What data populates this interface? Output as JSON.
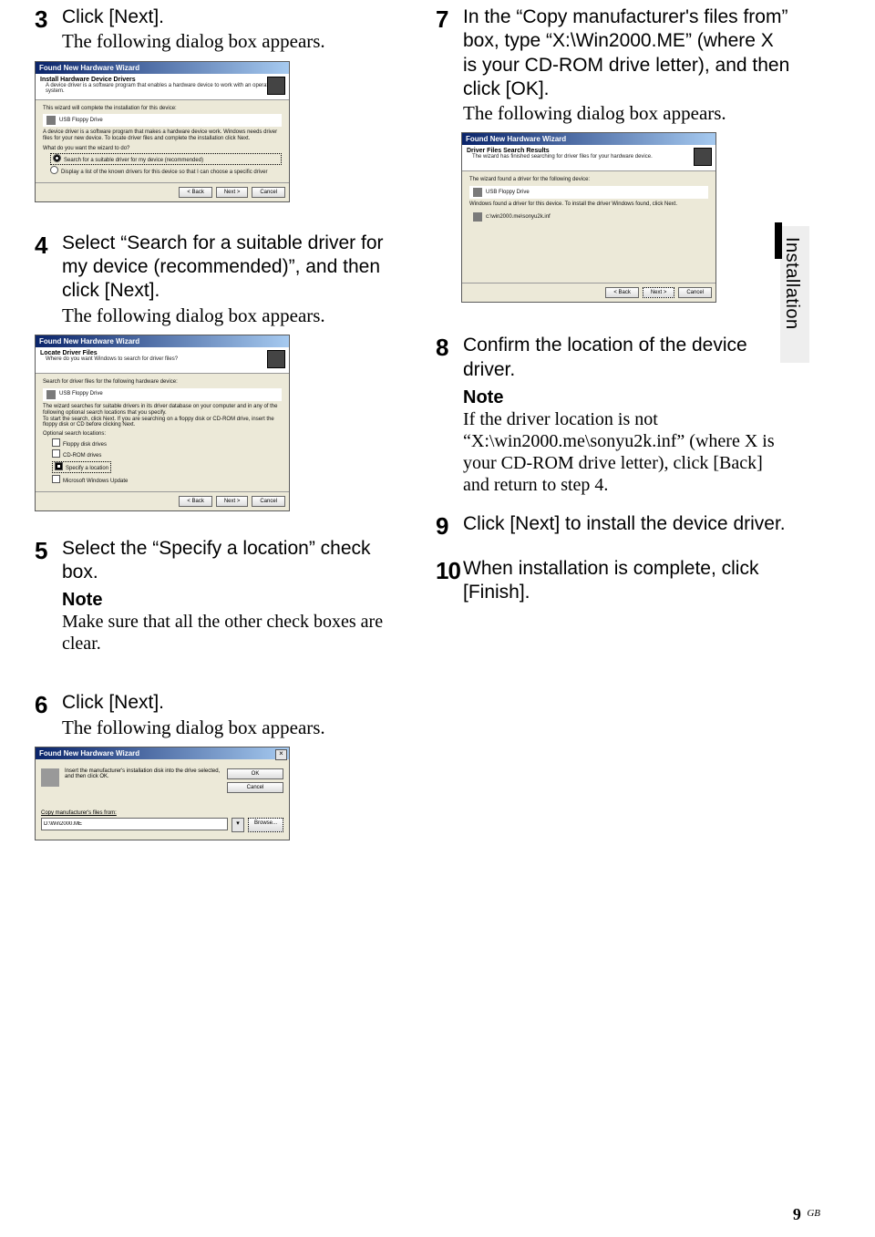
{
  "sideTab": "Installation",
  "pageNumber": "9",
  "pageLang": "GB",
  "left": {
    "s3": {
      "num": "3",
      "line1": "Click [Next].",
      "line2": "The following dialog box appears."
    },
    "wiz1": {
      "title": "Found New Hardware Wizard",
      "heading": "Install Hardware Device Drivers",
      "sub": "A device driver is a software program that enables a hardware device to work with an operating system.",
      "body1": "This wizard will complete the installation for this device:",
      "device": "USB Floppy Drive",
      "body2": "A device driver is a software program that makes a hardware device work. Windows needs driver files for your new device. To locate driver files and complete the installation click Next.",
      "q": "What do you want the wizard to do?",
      "opt1": "Search for a suitable driver for my device (recommended)",
      "opt2": "Display a list of the known drivers for this device so that I can choose a specific driver",
      "back": "< Back",
      "next": "Next >",
      "cancel": "Cancel"
    },
    "s4": {
      "num": "4",
      "line1": "Select “Search for a suitable driver for my device (recommended)”, and then click [Next].",
      "line2": "The following dialog box appears."
    },
    "wiz2": {
      "title": "Found New Hardware Wizard",
      "heading": "Locate Driver Files",
      "sub": "Where do you want Windows to search for driver files?",
      "body1": "Search for driver files for the following hardware device:",
      "device": "USB Floppy Drive",
      "body2": "The wizard searches for suitable drivers in its driver database on your computer and in any of the following optional search locations that you specify.",
      "body3": "To start the search, click Next. If you are searching on a floppy disk or CD-ROM drive, insert the floppy disk or CD before clicking Next.",
      "q": "Optional search locations:",
      "chk1": "Floppy disk drives",
      "chk2": "CD-ROM drives",
      "chk3": "Specify a location",
      "chk4": "Microsoft Windows Update",
      "back": "< Back",
      "next": "Next >",
      "cancel": "Cancel"
    },
    "s5": {
      "num": "5",
      "line1": "Select the “Specify a location” check box.",
      "note": "Note",
      "noteTxt": "Make sure that all the other check boxes are clear."
    },
    "s6": {
      "num": "6",
      "line1": "Click [Next].",
      "line2": "The following dialog box appears."
    },
    "wiz3": {
      "title": "Found New Hardware Wizard",
      "msg": "Insert the manufacturer's installation disk into the drive selected, and then click OK.",
      "ok": "OK",
      "cancel": "Cancel",
      "label": "Copy manufacturer's files from:",
      "path": "D:\\Win2000.ME",
      "browse": "Browse..."
    }
  },
  "right": {
    "s7": {
      "num": "7",
      "line1": "In the “Copy manufacturer's files from” box, type “X:\\Win2000.ME” (where X is your CD-ROM drive letter), and then click [OK].",
      "line2": "The following dialog box appears."
    },
    "wiz4": {
      "title": "Found New Hardware Wizard",
      "heading": "Driver Files Search Results",
      "sub": "The wizard has finished searching for driver files for your hardware device.",
      "body1": "The wizard found a driver for the following device:",
      "device": "USB Floppy Drive",
      "body2": "Windows found a driver for this device. To install the driver Windows found, click Next.",
      "path": "c:\\win2000.me\\sonyu2k.inf",
      "back": "< Back",
      "next": "Next >",
      "cancel": "Cancel"
    },
    "s8": {
      "num": "8",
      "line1": "Confirm the location of the device driver.",
      "note": "Note",
      "noteTxt": "If the driver location is not “X:\\win2000.me\\sonyu2k.inf” (where X is your CD-ROM drive letter), click [Back] and return to step 4."
    },
    "s9": {
      "num": "9",
      "line1": "Click [Next] to install the device driver."
    },
    "s10": {
      "num": "10",
      "line1": "When installation is complete, click [Finish]."
    }
  }
}
